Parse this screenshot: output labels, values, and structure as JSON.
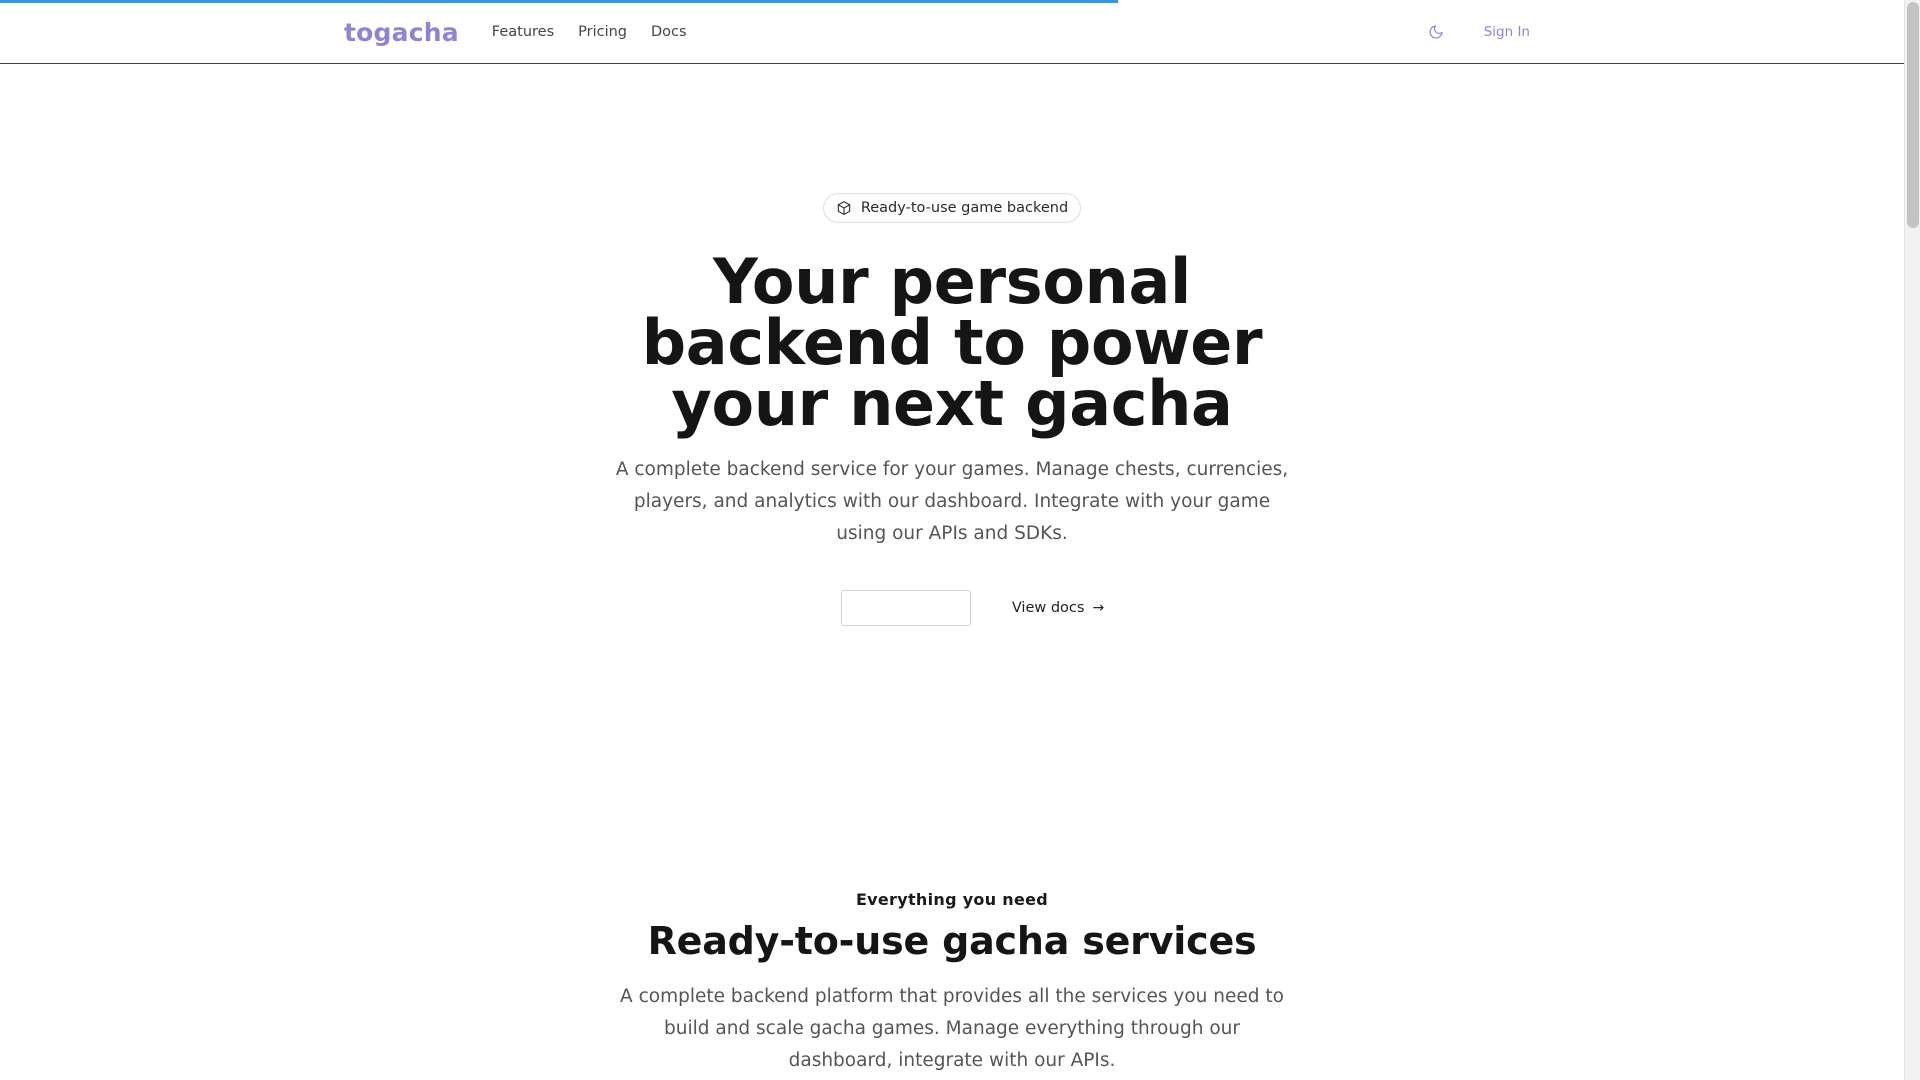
{
  "top_progress": {
    "value_percent": 58.7,
    "color": "#3b93de"
  },
  "brand": {
    "name": "togacha",
    "color": "#8f84d1"
  },
  "nav": {
    "links": [
      {
        "label": "Features"
      },
      {
        "label": "Pricing"
      },
      {
        "label": "Docs"
      }
    ],
    "theme_toggle_icon": "moon-icon",
    "sign_in_label": "Sign In"
  },
  "hero": {
    "badge_icon": "cube-icon",
    "badge_label": "Ready-to-use game backend",
    "title": "Your personal backend to power your next gacha",
    "description": "A complete backend service for your games. Manage chests, currencies, players, and analytics with our dashboard. Integrate with your game using our APIs and SDKs.",
    "primary_cta_label": "",
    "docs_cta_label": "View docs",
    "docs_cta_icon": "arrow-right-icon",
    "docs_cta_arrow": "→"
  },
  "features": {
    "eyebrow": "Everything you need",
    "title": "Ready-to-use gacha services",
    "description": "A complete backend platform that provides all the services you need to build and scale gacha games. Manage everything through our dashboard, integrate with our APIs."
  },
  "scrollbar": {
    "position_percent": 0
  }
}
